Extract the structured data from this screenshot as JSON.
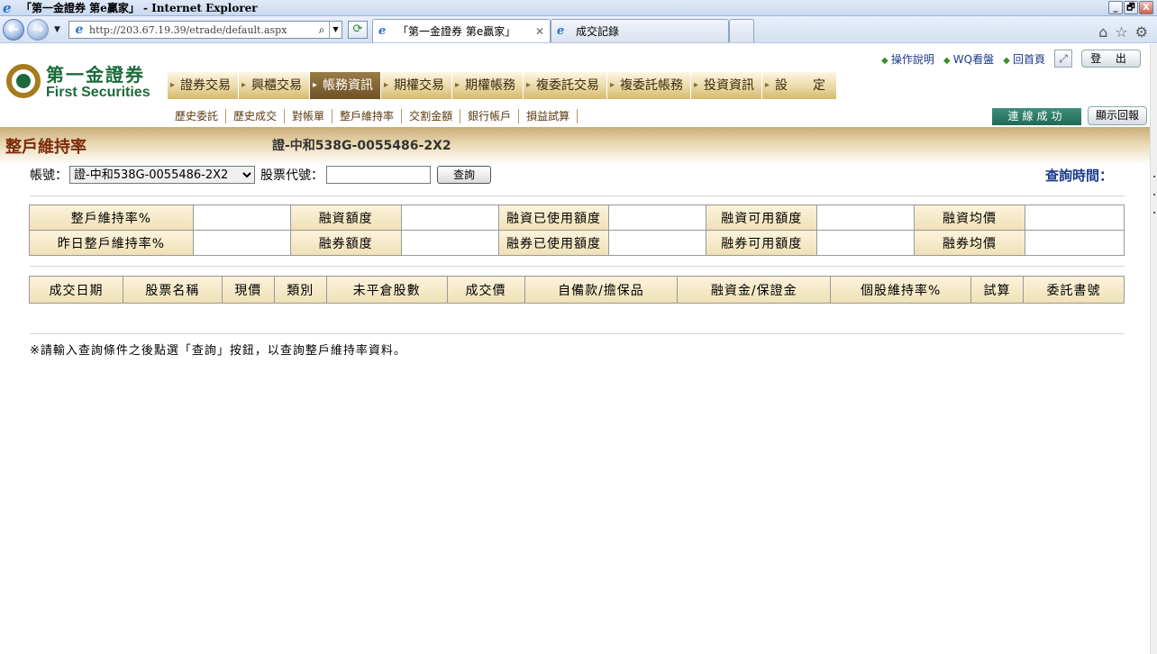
{
  "browser": {
    "title": "「第一金證券 第e贏家」 - Internet Explorer",
    "url": "http://203.67.19.39/etrade/default.aspx",
    "tabs": [
      {
        "label": "「第一金證券 第e贏家」",
        "active": true
      },
      {
        "label": "成交記錄",
        "active": false
      }
    ],
    "window_buttons": [
      "_",
      "🗗",
      "X"
    ]
  },
  "header": {
    "logo_cn": "第一金證券",
    "logo_en": "First Securities",
    "top_links": [
      "操作說明",
      "WQ看盤",
      "回首頁"
    ],
    "logout_label": "登 出",
    "connected_label": "連線成功",
    "show_report_label": "顯示回報"
  },
  "main_menu": [
    {
      "label": "證券交易",
      "active": false
    },
    {
      "label": "興櫃交易",
      "active": false
    },
    {
      "label": "帳務資訊",
      "active": true
    },
    {
      "label": "期權交易",
      "active": false
    },
    {
      "label": "期權帳務",
      "active": false
    },
    {
      "label": "複委託交易",
      "active": false
    },
    {
      "label": "複委託帳務",
      "active": false
    },
    {
      "label": "投資資訊",
      "active": false
    },
    {
      "label": "設　　定",
      "active": false
    }
  ],
  "sub_menu": [
    "歷史委託",
    "歷史成交",
    "對帳單",
    "整戶維持率",
    "交割金額",
    "銀行帳戶",
    "損益試算"
  ],
  "page": {
    "title": "整戶維持率",
    "account_display": "證-中和538G-0055486-2X2"
  },
  "query": {
    "account_label": "帳號：",
    "account_value": "證-中和538G-0055486-2X2",
    "stock_label": "股票代號：",
    "stock_value": "",
    "query_button": "查詢",
    "query_time_label": "查詢時間："
  },
  "summary": {
    "row1": [
      {
        "label": "整戶維持率%",
        "value": ""
      },
      {
        "label": "融資額度",
        "value": ""
      },
      {
        "label": "融資已使用額度",
        "value": ""
      },
      {
        "label": "融資可用額度",
        "value": ""
      },
      {
        "label": "融資均價",
        "value": ""
      }
    ],
    "row2": [
      {
        "label": "昨日整戶維持率%",
        "value": ""
      },
      {
        "label": "融券額度",
        "value": ""
      },
      {
        "label": "融券已使用額度",
        "value": ""
      },
      {
        "label": "融券可用額度",
        "value": ""
      },
      {
        "label": "融券均價",
        "value": ""
      }
    ]
  },
  "detail_columns": [
    "成交日期",
    "股票名稱",
    "現價",
    "類別",
    "未平倉股數",
    "成交價",
    "自備款/擔保品",
    "融資金/保證金",
    "個股維持率%",
    "試算",
    "委託書號"
  ],
  "note": "※請輸入查詢條件之後點選「查詢」按鈕，以查詢整戶維持率資料。"
}
